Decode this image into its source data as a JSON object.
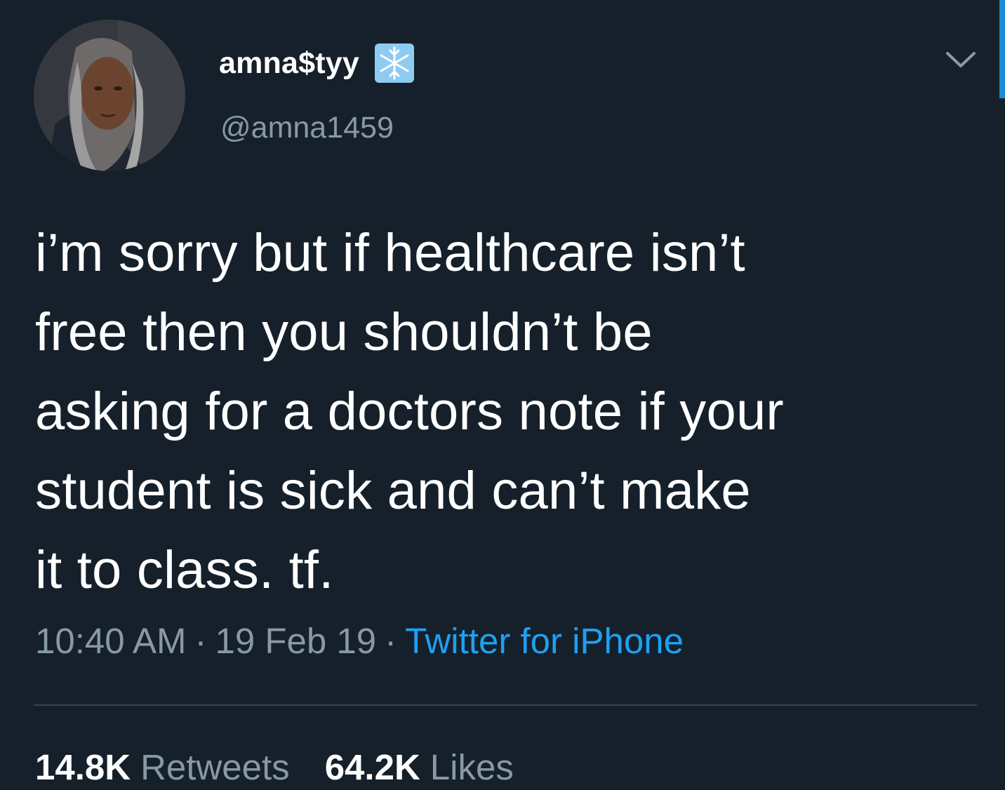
{
  "user": {
    "display_name": "amna$tyy",
    "handle": "@amna1459",
    "name_emoji": "snowflake-icon"
  },
  "tweet": {
    "text_lines": [
      "i’m sorry but if healthcare isn’t",
      "free then you shouldn’t be",
      "asking for a doctors note if your",
      "student is sick and can’t make",
      "it to class. tf."
    ]
  },
  "meta": {
    "time": "10:40 AM",
    "separator": "·",
    "date": "19 Feb 19",
    "source": "Twitter for iPhone"
  },
  "stats": {
    "retweets_count": "14.8K",
    "retweets_label": "Retweets",
    "likes_count": "64.2K",
    "likes_label": "Likes"
  },
  "colors": {
    "background": "#15202b",
    "text": "#ffffff",
    "secondary": "#8899a6",
    "accent": "#1da1f2",
    "divider": "#38444d"
  }
}
